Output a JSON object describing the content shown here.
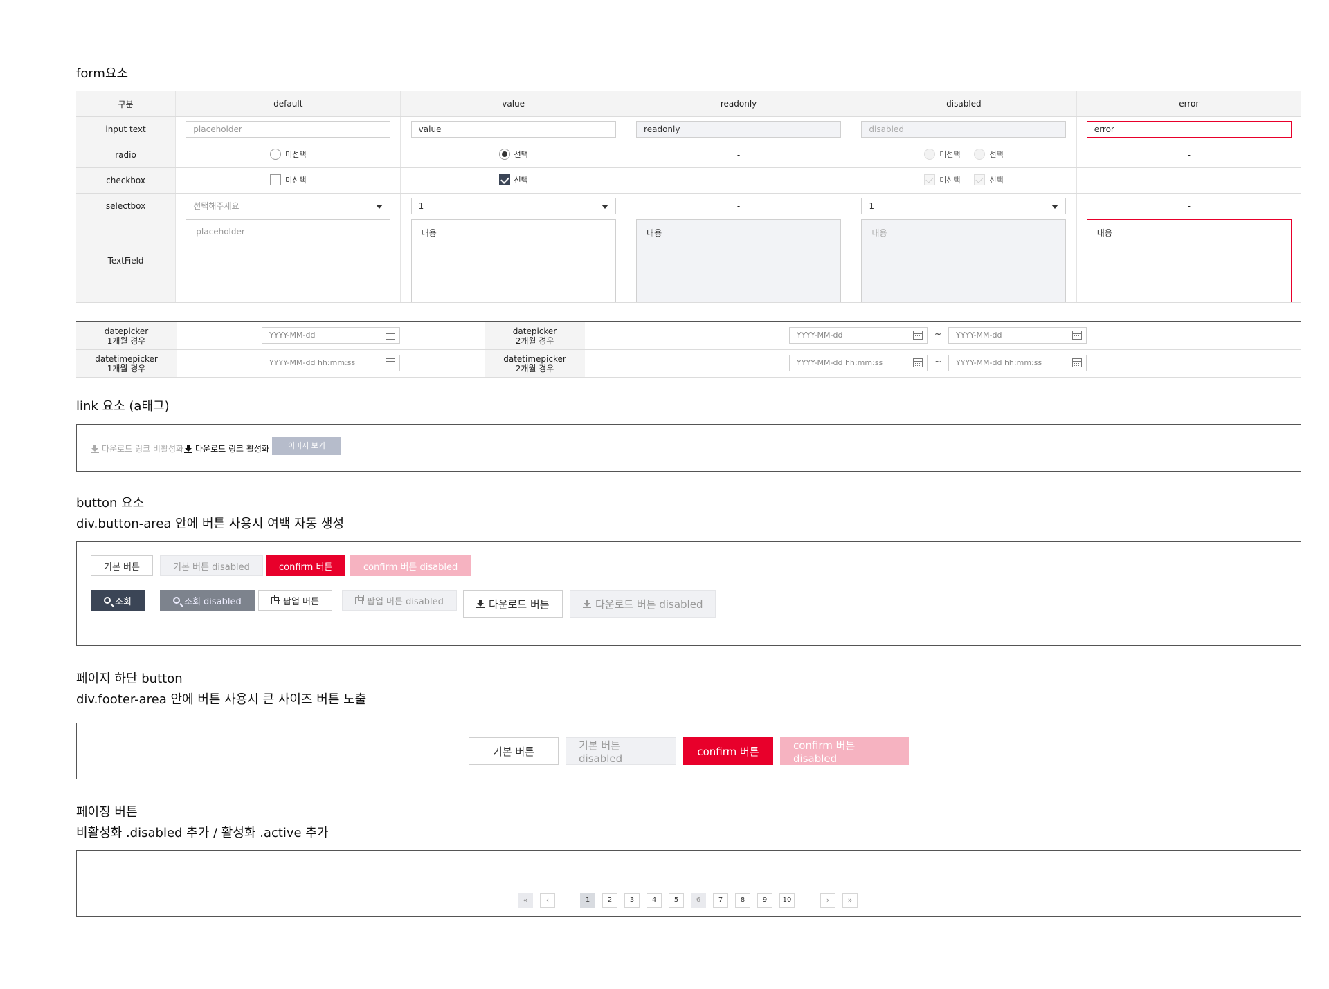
{
  "form": {
    "title": "form요소",
    "headers": [
      "구분",
      "default",
      "value",
      "readonly",
      "disabled",
      "error"
    ],
    "rows": {
      "input_label": "input text",
      "radio_label": "radio",
      "checkbox_label": "checkbox",
      "select_label": "selectbox",
      "textfield_label": "TextField"
    },
    "input": {
      "placeholder": "placeholder",
      "value": "value",
      "readonly": "readonly",
      "disabled": "disabled",
      "error": "error"
    },
    "radio": {
      "unselected": "미선택",
      "selected": "선택",
      "dash": "-"
    },
    "checkbox": {
      "unselected": "미선택",
      "selected": "선택",
      "dash": "-"
    },
    "select": {
      "placeholder": "선택해주세요",
      "value": "1",
      "disabled_value": "1",
      "dash": "-"
    },
    "textfield": {
      "placeholder": "placeholder",
      "value": "내용",
      "readonly": "내용",
      "disabled": "내용",
      "error": "내용"
    }
  },
  "dates": {
    "dp1_label_1": "datepicker",
    "dp1_label_2": "1개월 경우",
    "dp2_label_1": "datepicker",
    "dp2_label_2": "2개월 경우",
    "dtp1_label_1": "datetimepicker",
    "dtp1_label_2": "1개월 경우",
    "dtp2_label_1": "datetimepicker",
    "dtp2_label_2": "2개월 경우",
    "date_placeholder": "YYYY-MM-dd",
    "datetime_placeholder": "YYYY-MM-dd hh:mm:ss",
    "tilde": "~"
  },
  "links": {
    "title": "link 요소 (a태그)",
    "disabled": "다운로드 링크 비활성화",
    "active": "다운로드 링크 활성화",
    "image": "이미지 보기"
  },
  "buttons": {
    "title": "button 요소",
    "subtitle": "div.button-area 안에 버튼 사용시 여백 자동 생성",
    "basic": "기본 버튼",
    "basic_dis": "기본 버튼 disabled",
    "confirm": "confirm 버튼",
    "confirm_dis": "confirm 버튼 disabled",
    "search": "조회",
    "search_dis": "조회 disabled",
    "popup": "팝업 버튼",
    "popup_dis": "팝업 버튼 disabled",
    "download": "다운로드 버튼",
    "download_dis": "다운로드 버튼 disabled"
  },
  "footer": {
    "title": "페이지 하단 button",
    "subtitle": "div.footer-area 안에 버튼 사용시 큰 사이즈 버튼 노출",
    "basic": "기본 버튼",
    "basic_dis": "기본 버튼 disabled",
    "confirm": "confirm 버튼",
    "confirm_dis": "confirm 버튼 disabled"
  },
  "paging": {
    "title": "페이징 버튼",
    "subtitle": "비활성화 .disabled 추가 / 활성화 .active 추가",
    "first": "«",
    "prev": "‹",
    "next": "›",
    "last": "»",
    "pages": [
      "1",
      "2",
      "3",
      "4",
      "5",
      "6",
      "7",
      "8",
      "9",
      "10"
    ],
    "active_page": "1",
    "disabled_page": "6"
  },
  "colors": {
    "accent": "#e8002b",
    "dark": "#3b4556"
  }
}
